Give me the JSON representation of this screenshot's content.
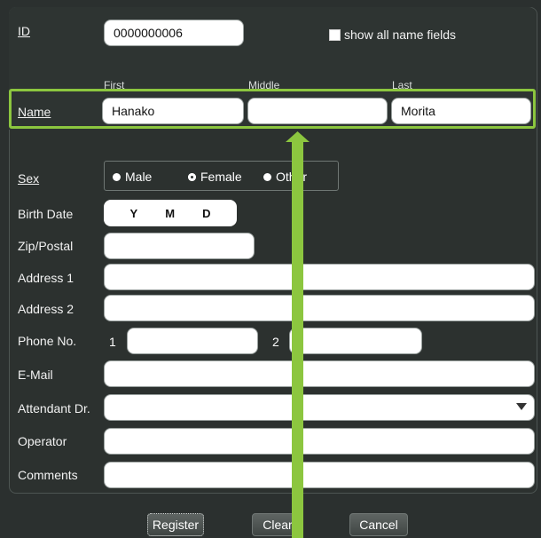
{
  "labels": {
    "id": "ID",
    "name": "Name",
    "sex": "Sex",
    "birth_date": "Birth Date",
    "zip": "Zip/Postal",
    "address1": "Address 1",
    "address2": "Address 2",
    "phone": "Phone No.",
    "email": "E-Mail",
    "attendant": "Attendant Dr.",
    "operator": "Operator",
    "comments": "Comments"
  },
  "id_value": "0000000006",
  "show_all_name_fields": {
    "label": "show all name fields",
    "checked": true
  },
  "name_headers": {
    "first": "First",
    "middle": "Middle",
    "last": "Last"
  },
  "name": {
    "first": "Hanako",
    "middle": "",
    "last": "Morita"
  },
  "sex_options": {
    "male": "Male",
    "female": "Female",
    "other": "Other",
    "selected": "Female"
  },
  "birth_date_parts": {
    "y": "Y",
    "m": "M",
    "d": "D"
  },
  "phone_numbers": {
    "one": "1",
    "two": "2"
  },
  "buttons": {
    "register": "Register",
    "clear": "Clear",
    "cancel": "Cancel"
  },
  "colors": {
    "highlight": "#8cc63f",
    "background": "#2b302f"
  }
}
